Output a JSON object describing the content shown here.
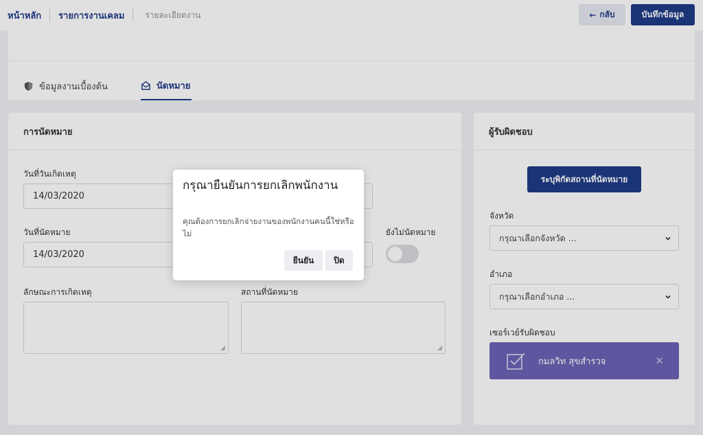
{
  "breadcrumb": {
    "home": "หน้าหลัก",
    "claims": "รายการงานเคลม",
    "current": "รายละเอียดงาน"
  },
  "header": {
    "back_label": "กลับ",
    "save_label": "บันทึกข้อมูล"
  },
  "tabs": {
    "basic": "ข้อมูลงานเบื้องต้น",
    "appointment": "นัดหมาย"
  },
  "appointment": {
    "title": "การนัดหมาย",
    "accident_date_label": "วันที่วันเกิดเหตุ",
    "accident_date_value": "14/03/2020",
    "appointment_date_label": "วันที่นัดหมาย",
    "appointment_date_value": "14/03/2020",
    "not_scheduled_label": "ยังไม่นัดหมาย",
    "not_scheduled_on": false,
    "incident_nature_label": "ลักษณะการเกิดเหตุ",
    "location_label": "สถานที่นัดหมาย"
  },
  "responsible": {
    "title": "ผู้รับผิดชอบ",
    "locate_button": "ระบุพิกัดสถานที่นัดหมาย",
    "province_label": "จังหวัด",
    "province_placeholder": "กรุณาเลือกจังหวัด ...",
    "district_label": "อำเภอ",
    "district_placeholder": "กรุณาเลือกอำเภอ ...",
    "surveyor_label": "เซอร์เวย์รับผิดชอบ",
    "surveyor_name": "กมลวิท สุขสำรวจ",
    "remove_symbol": "✕"
  },
  "modal": {
    "title": "กรุณายืนยันการยกเลิกพนักงาน",
    "body": "คุณต้องการยกเลิกจ่ายงานของพนักงานคนนี้ใช่หรือไม่",
    "confirm_label": "ยืนยัน",
    "close_label": "ปิด"
  },
  "colors": {
    "primary": "#1f3c88",
    "surveyor_card": "#6b62b5",
    "background": "#f0f1f5"
  }
}
